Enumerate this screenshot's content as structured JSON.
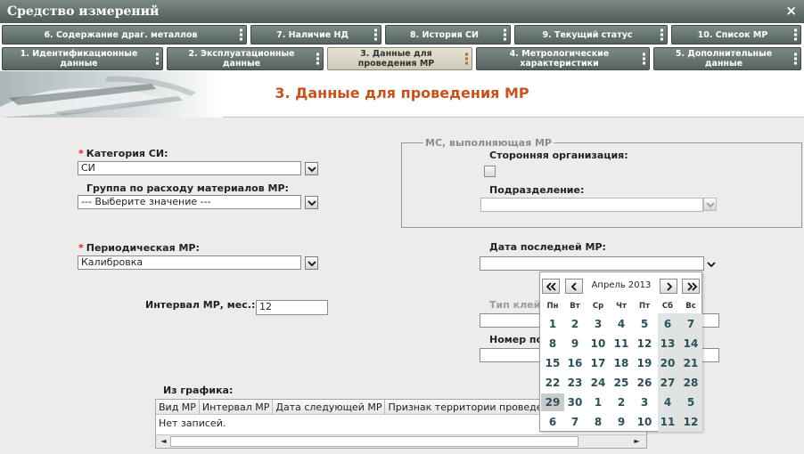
{
  "window": {
    "title": "Средство измерений",
    "close_glyph": "×"
  },
  "tabs_top": [
    "6. Содержание драг. металлов",
    "7. Наличие НД",
    "8. История СИ",
    "9. Текущий статус",
    "10. Список МР"
  ],
  "tabs_bottom": [
    "1. Идентификационные данные",
    "2. Эксплуатационные данные",
    "3. Данные для проведения МР",
    "4. Метрологические характеристики",
    "5. Дополнительные данные"
  ],
  "active_tab": "3. Данные для проведения МР",
  "page_title": "3. Данные для проведения МР",
  "form": {
    "required_mark": "*",
    "category_label": "Категория СИ:",
    "category_value": "СИ",
    "group_label": "Группа по расходу материалов МР:",
    "group_value": "--- Выберите значение ---",
    "periodic_label": "Периодическая МР:",
    "periodic_value": "Калибровка",
    "interval_label": "Интервал МР, мес.:",
    "interval_value": "12",
    "ms_legend": "МС, выполняющая МР",
    "third_party_label": "Сторонняя организация:",
    "third_party_checked": false,
    "division_label": "Подразделение:",
    "division_value": "",
    "last_date_label": "Дата последней МР:",
    "last_date_value": "",
    "stamp_type_label": "Тип клейм",
    "stamp_number_label": "Номер пов",
    "schedule_label": "Из графика:"
  },
  "grid": {
    "columns": [
      "Вид МР",
      "Интервал МР",
      "Дата следующей МР",
      "Признак территории проведения"
    ],
    "empty_text": "Нет записей.",
    "scroll_left": "◄",
    "scroll_right": "►"
  },
  "calendar": {
    "month_label": "Апрель 2013",
    "weekdays": [
      "Пн",
      "Вт",
      "Ср",
      "Чт",
      "Пт",
      "Сб",
      "Вс"
    ],
    "weeks": [
      [
        "1",
        "2",
        "3",
        "4",
        "5",
        "6",
        "7"
      ],
      [
        "8",
        "9",
        "10",
        "11",
        "12",
        "13",
        "14"
      ],
      [
        "15",
        "16",
        "17",
        "18",
        "19",
        "20",
        "21"
      ],
      [
        "22",
        "23",
        "24",
        "25",
        "26",
        "27",
        "28"
      ],
      [
        "29",
        "30",
        "1",
        "2",
        "3",
        "4",
        "5"
      ],
      [
        "6",
        "7",
        "8",
        "9",
        "10",
        "11",
        "12"
      ]
    ],
    "today": "29",
    "colors": {
      "day_text": "#2d4f59",
      "weekend_bg": "#dfe3e2"
    }
  },
  "colors": {
    "title_accent": "#c4541f",
    "tab_bg": "#566360",
    "required": "#d4241c"
  }
}
